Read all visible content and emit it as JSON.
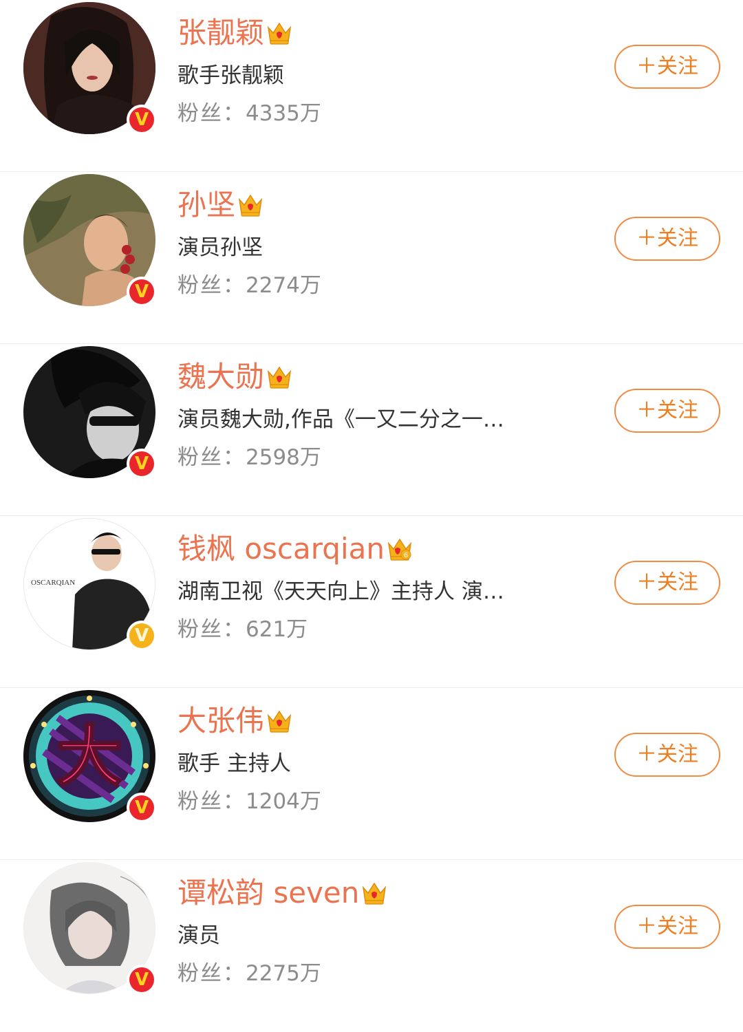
{
  "colors": {
    "name": "#eb7350",
    "follow_border": "#f18a43",
    "follow_text": "#f07d20",
    "desc": "#333333",
    "fans": "#8c8c8c",
    "badge_red": "#e8262b",
    "badge_gold": "#f6b21b",
    "divider": "#ececec"
  },
  "follow_label": "＋关注",
  "fans_label": "粉丝：",
  "verified_glyph": "V",
  "users": [
    {
      "name": "张靓颖",
      "desc": "歌手张靓颖",
      "fans": "4335万",
      "badge": "red",
      "crown": "crown-icon",
      "avatar": "portrait-photo"
    },
    {
      "name": "孙坚",
      "desc": "演员孙坚",
      "fans": "2274万",
      "badge": "red",
      "crown": "crown-icon",
      "avatar": "child-photo"
    },
    {
      "name": "魏大勋",
      "desc": "演员魏大勋,作品《一又二分之一…",
      "fans": "2598万",
      "badge": "red",
      "crown": "crown-icon",
      "avatar": "bw-portrait-photo"
    },
    {
      "name": "钱枫 oscarqian",
      "desc": "湖南卫视《天天向上》主持人 演…",
      "fans": "621万",
      "badge": "gold",
      "crown": "crown-6-icon",
      "avatar": "illustration",
      "avatar_text": "OSCARQIAN"
    },
    {
      "name": "大张伟",
      "desc": "歌手 主持人",
      "fans": "1204万",
      "badge": "red",
      "crown": "crown-icon",
      "avatar": "logo-badge",
      "avatar_text": "大"
    },
    {
      "name": "谭松韵 seven",
      "desc": "演员",
      "fans": "2275万",
      "badge": "red",
      "crown": "crown-icon",
      "avatar": "light-portrait-photo"
    }
  ]
}
